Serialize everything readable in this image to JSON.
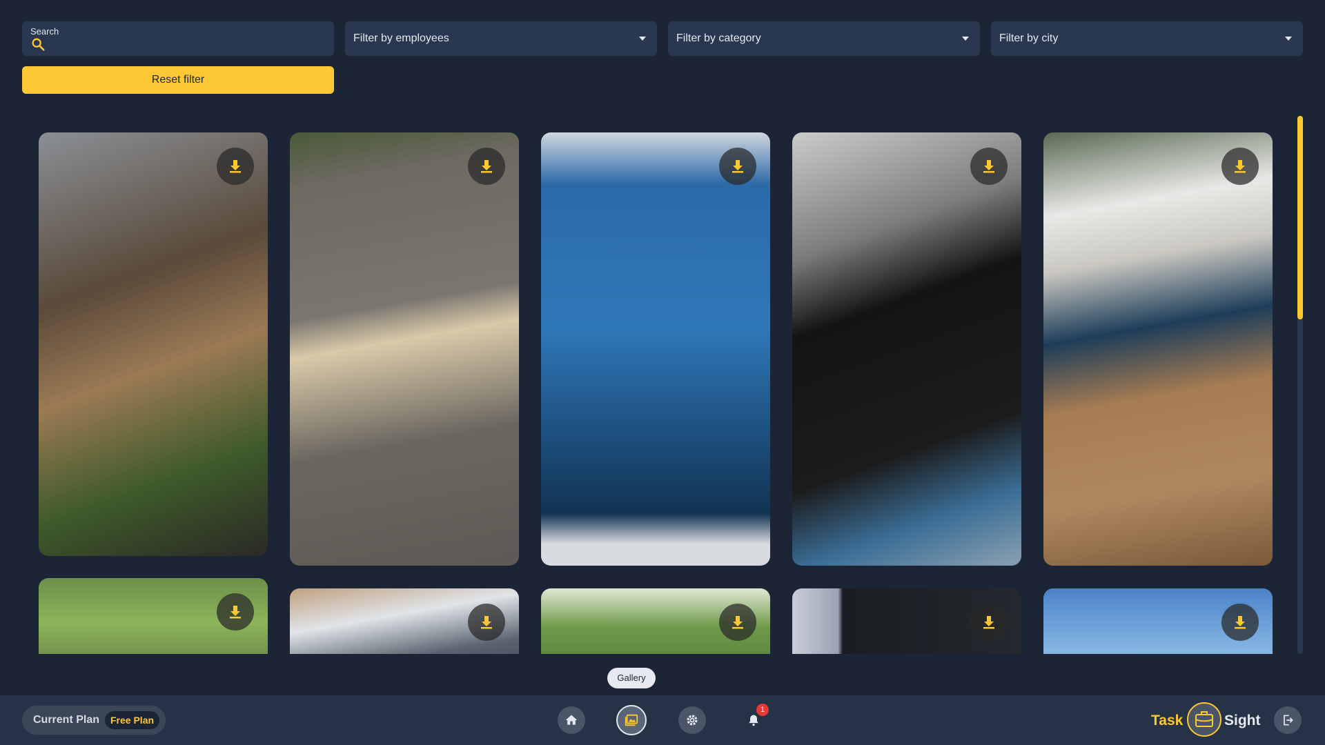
{
  "filters": {
    "search_label": "Search",
    "search_value": "",
    "employees": "Filter by employees",
    "category": "Filter by category",
    "city": "Filter by city",
    "reset_label": "Reset filter"
  },
  "gallery": {
    "photos": [
      {
        "subject": "woven basket and plant by window"
      },
      {
        "subject": "labrador dog"
      },
      {
        "subject": "monitor showing project app"
      },
      {
        "subject": "zoom recorder"
      },
      {
        "subject": "white flowers in blue vase"
      },
      {
        "subject": "trees outdoors"
      },
      {
        "subject": "laptop on desk"
      },
      {
        "subject": "tripod under trees"
      },
      {
        "subject": "code on screens"
      },
      {
        "subject": "blue sky"
      }
    ],
    "download_icon": "download-icon"
  },
  "tooltip": "Gallery",
  "bottom_bar": {
    "plan_label": "Current Plan",
    "plan_badge": "Free Plan",
    "notification_count": "1",
    "logo_left": "Task",
    "logo_right": "Sight",
    "nav_icons": [
      "home-icon",
      "gallery-icon",
      "settings-icon",
      "bell-icon"
    ]
  },
  "colors": {
    "accent": "#fcc934",
    "background": "#1c2536",
    "panel": "#2a3750",
    "bar": "#263246"
  }
}
